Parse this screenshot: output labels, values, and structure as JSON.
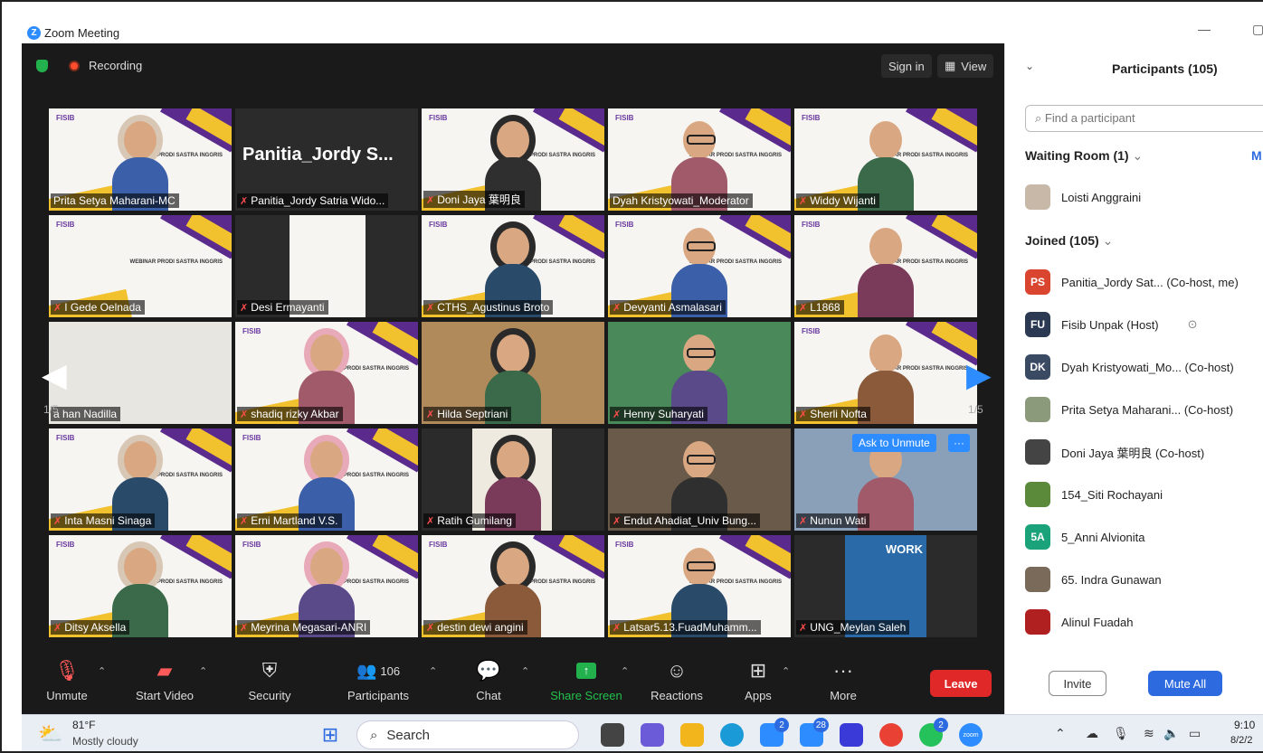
{
  "window": {
    "app_icon": "Z",
    "title": "Zoom Meeting"
  },
  "topbar": {
    "recording": "Recording",
    "sign_in": "Sign in",
    "view": "View"
  },
  "tiles": [
    {
      "name": "Prita Setya Maharani-MC",
      "muted": false,
      "kind": "slide-person",
      "active": true
    },
    {
      "name": "Panitia_Jordy Satria Wido...",
      "big": "Panitia_Jordy  S...",
      "muted": true,
      "kind": "name-only"
    },
    {
      "name": "Doni Jaya 葉明良",
      "muted": true,
      "kind": "slide-person"
    },
    {
      "name": "Dyah Kristyowati_Moderator",
      "muted": false,
      "kind": "slide-person"
    },
    {
      "name": "Widdy Wijanti",
      "muted": true,
      "kind": "slide-person"
    },
    {
      "name": "I Gede Oelnada",
      "muted": true,
      "kind": "slide"
    },
    {
      "name": "Desi Ermayanti",
      "muted": true,
      "kind": "slide-narrow"
    },
    {
      "name": "CTHS_Agustinus Broto",
      "muted": true,
      "kind": "slide-person"
    },
    {
      "name": "Devyanti Asmalasari",
      "muted": true,
      "kind": "slide-person"
    },
    {
      "name": "L1868",
      "muted": true,
      "kind": "slide-person"
    },
    {
      "name": "a han Nadilla",
      "muted": false,
      "kind": "wall"
    },
    {
      "name": "shadiq rizky Akbar",
      "muted": true,
      "kind": "slide-person"
    },
    {
      "name": "Hilda Septriani",
      "muted": true,
      "kind": "room"
    },
    {
      "name": "Henny Suharyati",
      "muted": true,
      "kind": "garden"
    },
    {
      "name": "Sherli Nofta",
      "muted": true,
      "kind": "slide-person"
    },
    {
      "name": "Inta Masni Sinaga",
      "muted": true,
      "kind": "slide-person"
    },
    {
      "name": "Erni Martland V.S.",
      "muted": true,
      "kind": "slide-person"
    },
    {
      "name": "Ratih Gumilang",
      "muted": true,
      "kind": "portrait"
    },
    {
      "name": "Endut Ahadiat_Univ Bung...",
      "muted": true,
      "kind": "shelf"
    },
    {
      "name": "Nunun Wati",
      "muted": true,
      "kind": "outdoor",
      "ask": "Ask to Unmute",
      "more": "···"
    },
    {
      "name": "Ditsy Aksella",
      "muted": true,
      "kind": "slide-person"
    },
    {
      "name": "Meyrina Megasari-ANRI",
      "muted": true,
      "kind": "slide-person"
    },
    {
      "name": "destin dewi angini",
      "muted": true,
      "kind": "slide-person"
    },
    {
      "name": "Latsar5.13.FuadMuhamm...",
      "muted": true,
      "kind": "slide-person"
    },
    {
      "name": "UNG_Meylan Saleh",
      "muted": true,
      "kind": "work"
    }
  ],
  "slide": {
    "fisib": "FISIB",
    "webinar": "WEBINAR PRODI SASTRA INGGRIS",
    "work": "WORK"
  },
  "pager": {
    "left": "1/5",
    "right": "1/5"
  },
  "controls": {
    "unmute": "Unmute",
    "start_video": "Start Video",
    "security": "Security",
    "participants": "Participants",
    "participants_count": "106",
    "chat": "Chat",
    "share_screen": "Share Screen",
    "reactions": "Reactions",
    "apps": "Apps",
    "more": "More",
    "leave": "Leave"
  },
  "panel": {
    "title": "Participants (105)",
    "search_placeholder": "Find a participant",
    "waiting_room": "Waiting Room (1)",
    "waiting_more": "M",
    "waiting": [
      {
        "name": "Loisti Anggraini"
      }
    ],
    "joined": "Joined (105)",
    "people": [
      {
        "initials": "PS",
        "color": "#d9452f",
        "name": "Panitia_Jordy Sat... (Co-host, me)"
      },
      {
        "initials": "FU",
        "color": "#2b3a52",
        "name": "Fisib Unpak (Host)",
        "extra": "⊙"
      },
      {
        "initials": "DK",
        "color": "#3a4a63",
        "name": "Dyah Kristyowati_Mo... (Co-host)"
      },
      {
        "initials": "",
        "color": "#8a9a7a",
        "name": "Prita Setya Maharani... (Co-host)"
      },
      {
        "initials": "",
        "color": "#444444",
        "name": "Doni Jaya 葉明良 (Co-host)"
      },
      {
        "initials": "",
        "color": "#5a8a3a",
        "name": "154_Siti Rochayani"
      },
      {
        "initials": "5A",
        "color": "#1aa37a",
        "name": "5_Anni Alvionita"
      },
      {
        "initials": "",
        "color": "#7a6a5a",
        "name": "65. Indra Gunawan"
      },
      {
        "initials": "",
        "color": "#b02020",
        "name": "Alinul Fuadah"
      }
    ],
    "invite": "Invite",
    "mute_all": "Mute All"
  },
  "taskbar": {
    "temp": "81°F",
    "weather": "Mostly cloudy",
    "search": "Search",
    "time": "9:10",
    "date": "8/2/2",
    "badges": {
      "c1": "2",
      "c2": "28",
      "c3": "2"
    },
    "zoom_icon_label": "zoom"
  }
}
